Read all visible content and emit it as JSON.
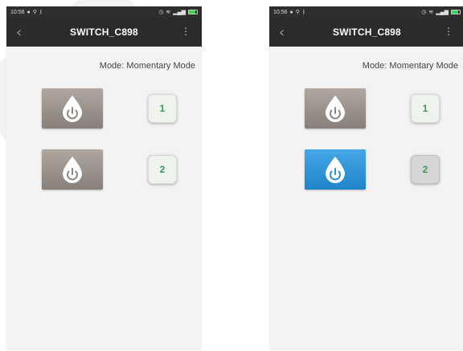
{
  "screens": [
    {
      "status": {
        "time": "10:56"
      },
      "toolbar": {
        "title": "SWITCH_C898",
        "back_icon": "chevron-left-icon",
        "menu_icon": "overflow-menu-icon"
      },
      "mode_text": "Mode: Momentary Mode",
      "switches": [
        {
          "state": "off",
          "label": "1"
        },
        {
          "state": "off",
          "label": "2"
        }
      ]
    },
    {
      "status": {
        "time": "10:56"
      },
      "toolbar": {
        "title": "SWITCH_C898",
        "back_icon": "chevron-left-icon",
        "menu_icon": "overflow-menu-icon"
      },
      "mode_text": "Mode: Momentary Mode",
      "switches": [
        {
          "state": "off",
          "label": "1"
        },
        {
          "state": "on",
          "label": "2"
        }
      ]
    }
  ],
  "colors": {
    "off_button": "#8f8782",
    "on_button": "#2b8fd4",
    "label_green": "#3a9a55",
    "toolbar": "#2b2b2b"
  }
}
